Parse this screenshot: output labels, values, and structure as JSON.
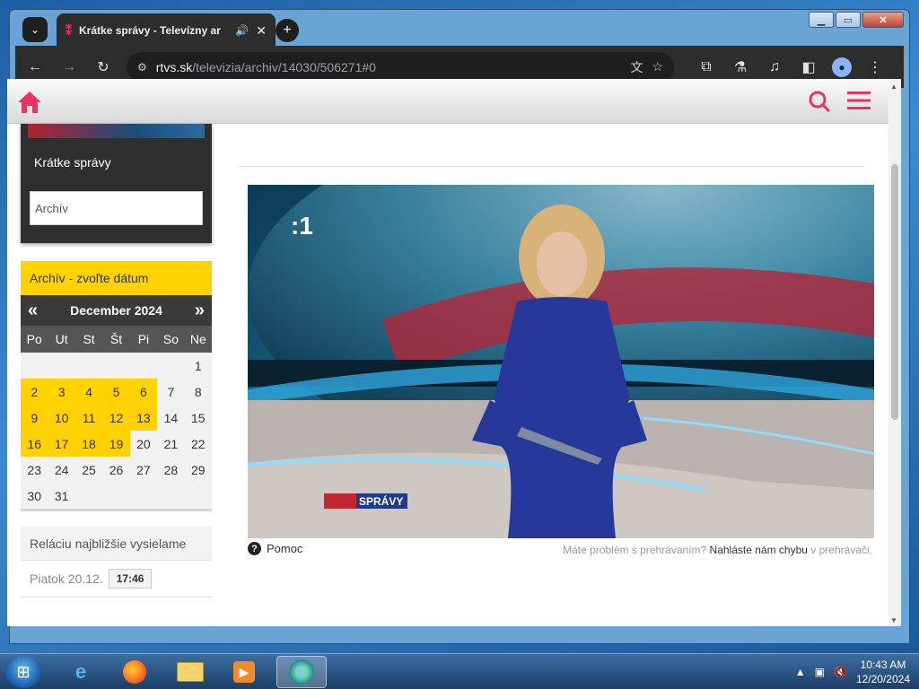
{
  "browser": {
    "tab_title": "Krátke správy - Televízny ar",
    "url_host": "rtvs.sk",
    "url_path": "/televizia/archiv/14030/506271#0"
  },
  "sidebar": {
    "show_title": "Krátke správy",
    "archive_input_value": "Archív",
    "calendar": {
      "header": "Archív - zvoľte dátum",
      "month": "December 2024",
      "prev": "«",
      "next": "»",
      "weekdays": [
        "Po",
        "Ut",
        "St",
        "Št",
        "Pi",
        "So",
        "Ne"
      ],
      "days": [
        {
          "d": ""
        },
        {
          "d": ""
        },
        {
          "d": ""
        },
        {
          "d": ""
        },
        {
          "d": ""
        },
        {
          "d": ""
        },
        {
          "d": "1"
        },
        {
          "d": "2",
          "has": true
        },
        {
          "d": "3",
          "has": true
        },
        {
          "d": "4",
          "has": true
        },
        {
          "d": "5",
          "has": true
        },
        {
          "d": "6",
          "has": true
        },
        {
          "d": "7"
        },
        {
          "d": "8"
        },
        {
          "d": "9",
          "has": true
        },
        {
          "d": "10",
          "has": true
        },
        {
          "d": "11",
          "has": true
        },
        {
          "d": "12",
          "has": true
        },
        {
          "d": "13",
          "has": true
        },
        {
          "d": "14"
        },
        {
          "d": "15"
        },
        {
          "d": "16",
          "has": true
        },
        {
          "d": "17",
          "has": true
        },
        {
          "d": "18",
          "has": true
        },
        {
          "d": "19",
          "has": true
        },
        {
          "d": "20"
        },
        {
          "d": "21"
        },
        {
          "d": "22"
        },
        {
          "d": "23"
        },
        {
          "d": "24"
        },
        {
          "d": "25"
        },
        {
          "d": "26"
        },
        {
          "d": "27"
        },
        {
          "d": "28"
        },
        {
          "d": "29"
        },
        {
          "d": "30"
        },
        {
          "d": "31"
        },
        {
          "d": ""
        },
        {
          "d": ""
        },
        {
          "d": ""
        },
        {
          "d": ""
        },
        {
          "d": ""
        }
      ]
    },
    "next_broadcast": {
      "header": "Reláciu najbližšie vysielame",
      "date": "Piatok 20.12.",
      "time": "17:46"
    }
  },
  "player": {
    "channel_logo": ":1",
    "lower_label": "SPRÁVY"
  },
  "below_player": {
    "help": "Pomoc",
    "report_prefix": "Máte problém s prehrávaním?",
    "report_link": "Nahláste nám chybu",
    "report_suffix": "v prehrávači."
  },
  "taskbar": {
    "time": "10:43 AM",
    "date": "12/20/2024"
  },
  "colors": {
    "accent": "#e8336a",
    "calendar_yellow": "#ffd200"
  }
}
